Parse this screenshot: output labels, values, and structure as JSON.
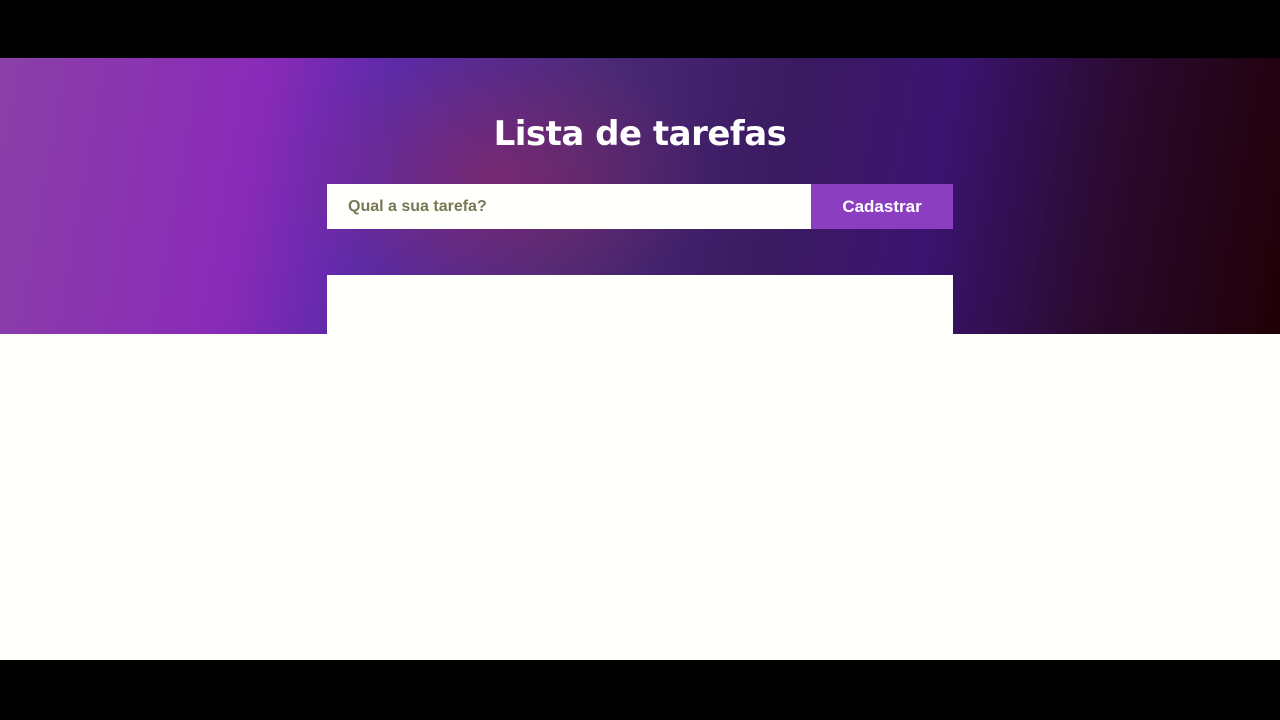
{
  "header": {
    "title": "Lista de tarefas"
  },
  "form": {
    "input_value": "",
    "input_placeholder": "Qual a sua tarefa?",
    "submit_label": "Cadastrar"
  },
  "task_list": {
    "items": []
  },
  "colors": {
    "accent": "#8b3fc0"
  }
}
